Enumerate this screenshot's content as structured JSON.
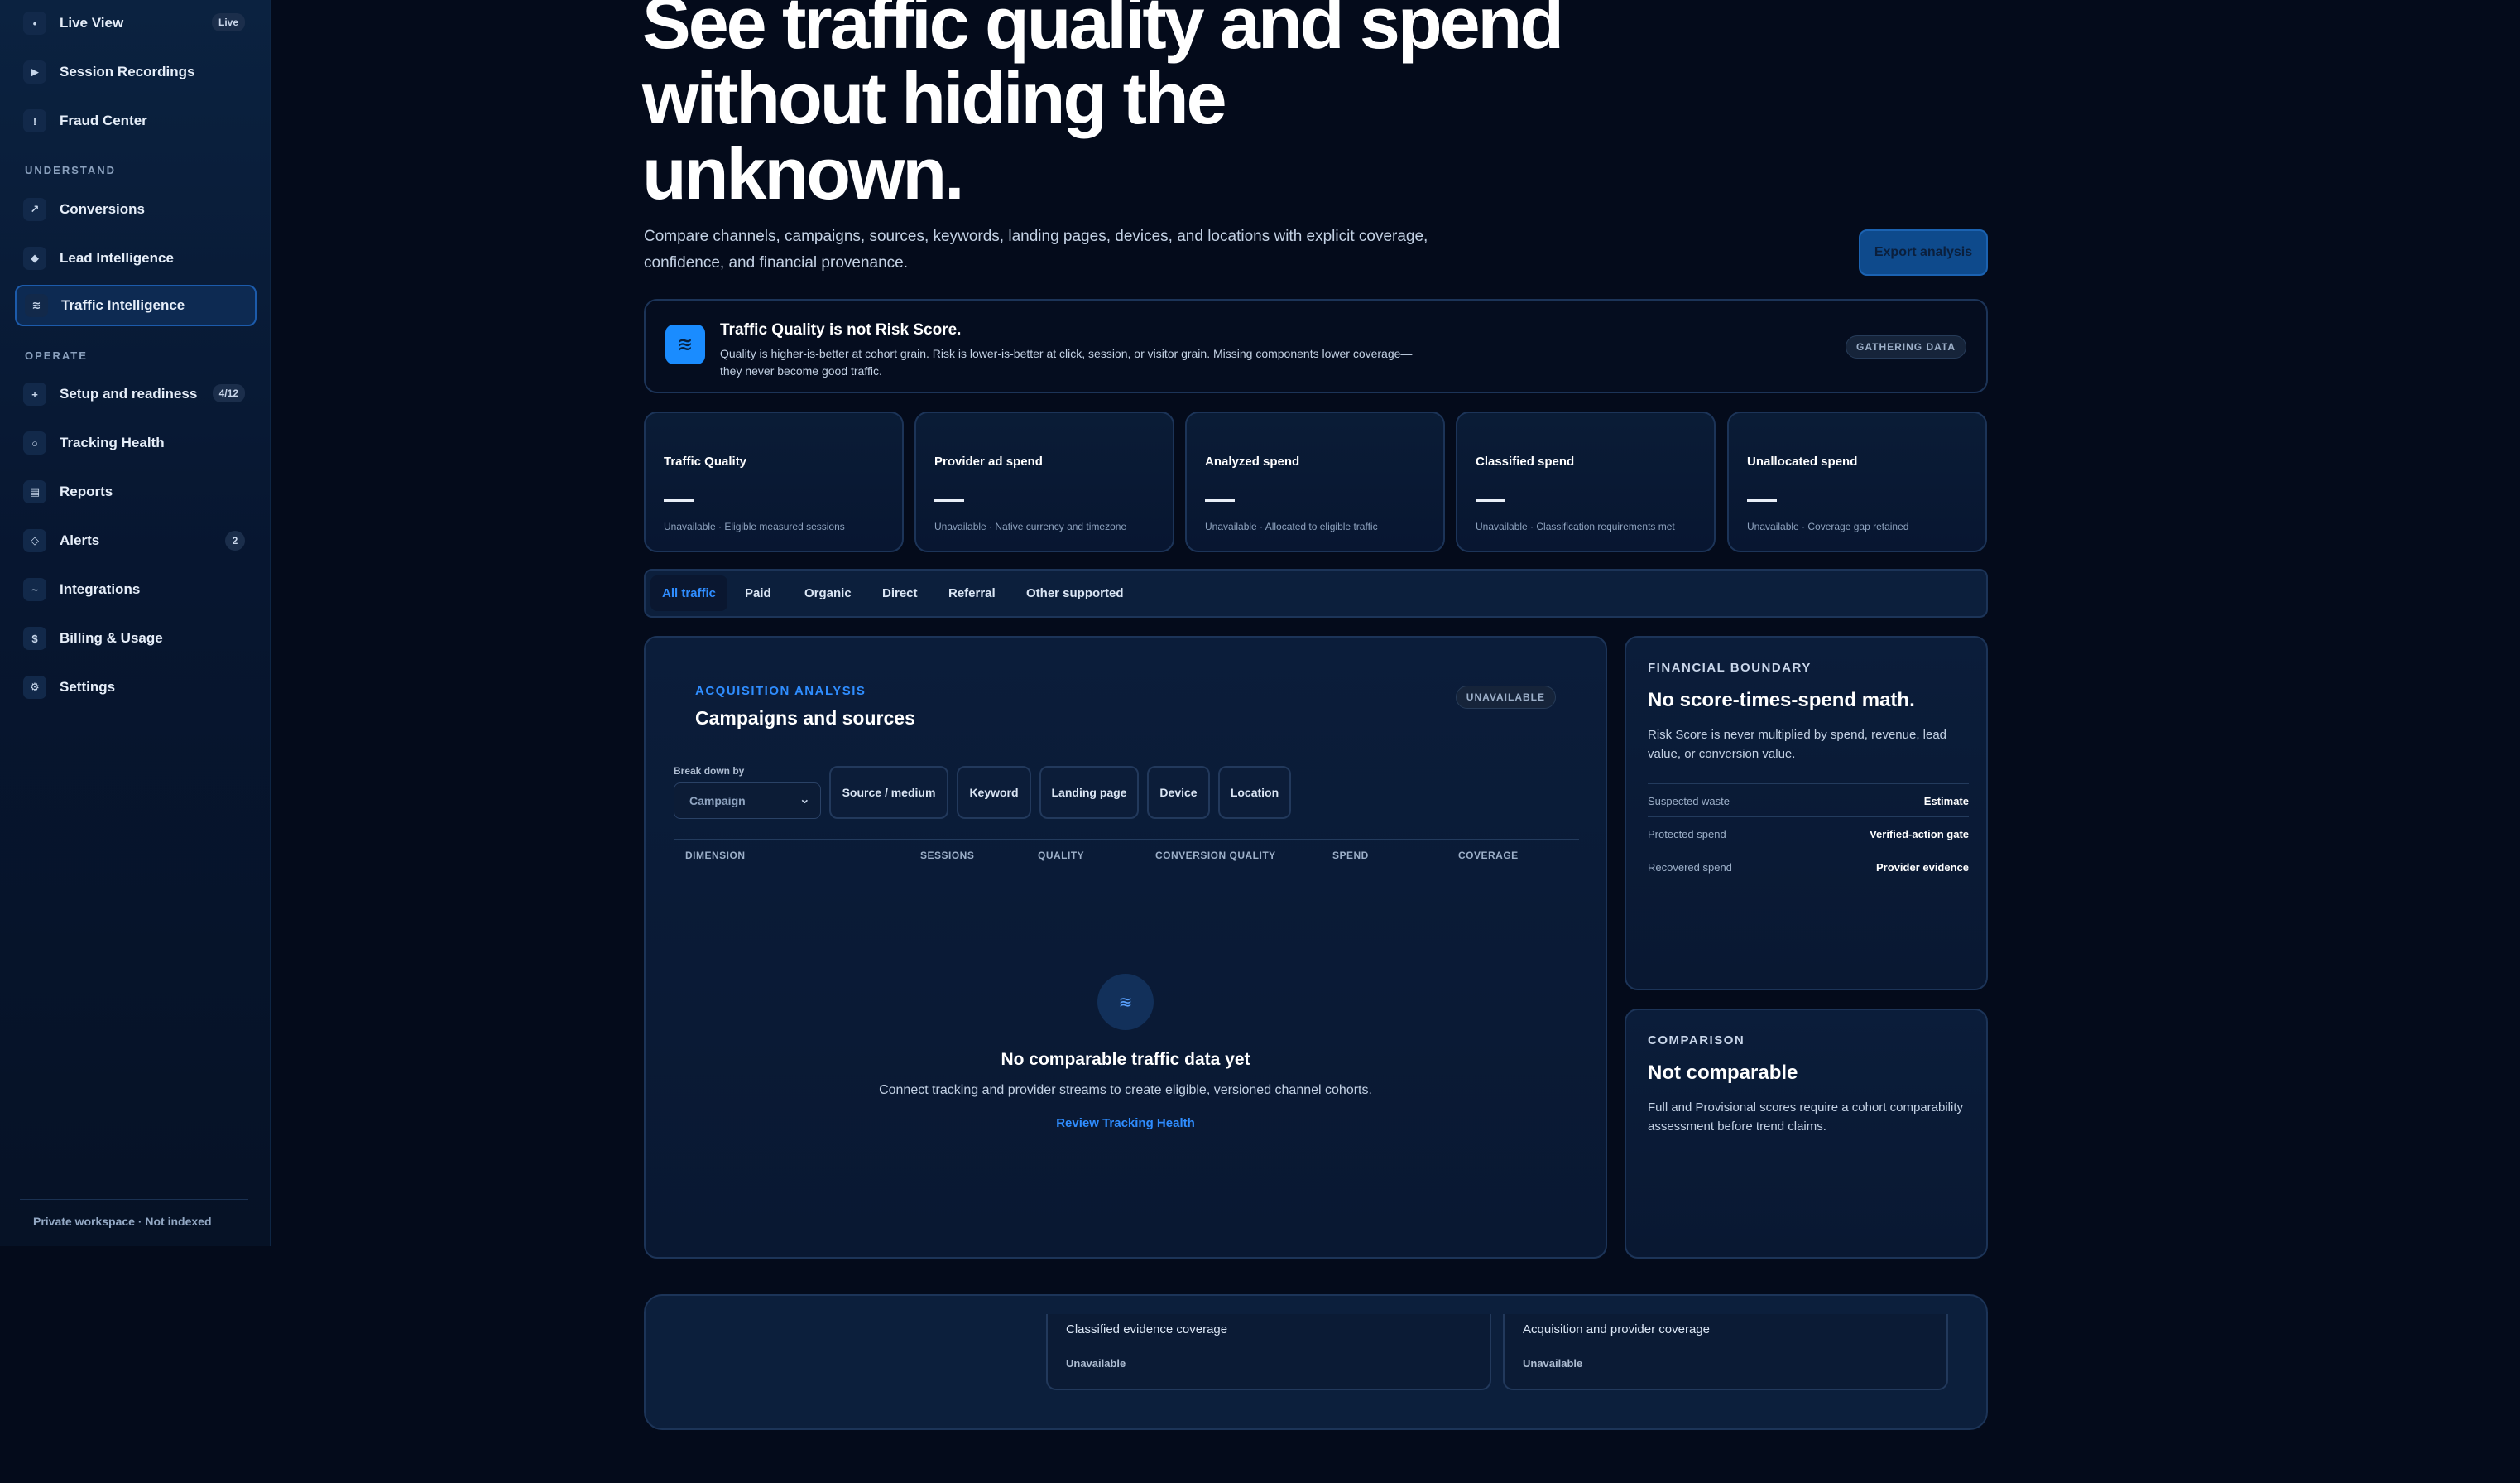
{
  "sidebar": {
    "items_top": [
      {
        "label": "Live View",
        "icon": "•",
        "badge": "Live"
      },
      {
        "label": "Session Recordings",
        "icon": "▶"
      },
      {
        "label": "Fraud Center",
        "icon": "!"
      }
    ],
    "section_understand": "UNDERSTAND",
    "items_understand": [
      {
        "label": "Conversions",
        "icon": "↗"
      },
      {
        "label": "Lead Intelligence",
        "icon": "◆"
      },
      {
        "label": "Traffic Intelligence",
        "icon": "≋"
      }
    ],
    "section_operate": "OPERATE",
    "items_operate": [
      {
        "label": "Setup and readiness",
        "icon": "+",
        "badge": "4/12"
      },
      {
        "label": "Tracking Health",
        "icon": "○"
      },
      {
        "label": "Reports",
        "icon": "▤"
      },
      {
        "label": "Alerts",
        "icon": "◇",
        "badge": "2"
      },
      {
        "label": "Integrations",
        "icon": "~"
      },
      {
        "label": "Billing & Usage",
        "icon": "$"
      },
      {
        "label": "Settings",
        "icon": "⚙"
      }
    ],
    "footer": "Private workspace · Not indexed"
  },
  "hero": {
    "title_line1": "See traffic quality and spend",
    "title_line2": "without hiding the",
    "title_line3": "unknown.",
    "subtitle_line1": "Compare channels, campaigns, sources, keywords, landing pages, devices, and locations with explicit coverage,",
    "subtitle_line2": "confidence, and financial provenance.",
    "export_label": "Export analysis"
  },
  "banner": {
    "icon": "≋",
    "title": "Traffic Quality is not Risk Score.",
    "text_line1": "Quality is higher-is-better at cohort grain. Risk is lower-is-better at click, session, or visitor grain. Missing components lower coverage—",
    "text_line2": "they never become good traffic.",
    "status": "GATHERING DATA"
  },
  "metrics": [
    {
      "title": "Traffic Quality",
      "foot": "Unavailable · Eligible measured sessions"
    },
    {
      "title": "Provider ad spend",
      "foot": "Unavailable · Native currency and timezone"
    },
    {
      "title": "Analyzed spend",
      "foot": "Unavailable · Allocated to eligible traffic"
    },
    {
      "title": "Classified spend",
      "foot": "Unavailable · Classification requirements met"
    },
    {
      "title": "Unallocated spend",
      "foot": "Unavailable · Coverage gap retained"
    }
  ],
  "tabs": [
    "All traffic",
    "Paid",
    "Organic",
    "Direct",
    "Referral",
    "Other supported"
  ],
  "analysis": {
    "eyebrow": "ACQUISITION ANALYSIS",
    "title": "Campaigns and sources",
    "status": "UNAVAILABLE",
    "breakdown_label": "Break down by",
    "breakdown_value": "Campaign",
    "segments": [
      "Source / medium",
      "Keyword",
      "Landing page",
      "Device",
      "Location"
    ],
    "columns": [
      "DIMENSION",
      "SESSIONS",
      "QUALITY",
      "CONVERSION QUALITY",
      "SPEND",
      "COVERAGE"
    ],
    "empty_icon": "≋",
    "empty_title": "No comparable traffic data yet",
    "empty_text": "Connect tracking and provider streams to create eligible, versioned channel cohorts.",
    "empty_link": "Review Tracking Health"
  },
  "financial": {
    "eyebrow": "FINANCIAL BOUNDARY",
    "title": "No score-times-spend math.",
    "text_line1": "Risk Score is never multiplied by spend, revenue, lead",
    "text_line2": "value, or conversion value.",
    "rows": [
      {
        "k": "Suspected waste",
        "v": "Estimate"
      },
      {
        "k": "Protected spend",
        "v": "Verified-action gate"
      },
      {
        "k": "Recovered spend",
        "v": "Provider evidence"
      }
    ]
  },
  "comparison": {
    "eyebrow": "COMPARISON",
    "title": "Not comparable",
    "text_line1": "Full and Provisional scores require a cohort comparability",
    "text_line2": "assessment before trend claims."
  },
  "coverage": [
    {
      "title": "Classified evidence coverage",
      "value": "Unavailable"
    },
    {
      "title": "Acquisition and provider coverage",
      "value": "Unavailable"
    }
  ],
  "colors": {
    "accent": "#2f8dff",
    "background": "#040b1b",
    "panel": "#0b1d3a"
  }
}
